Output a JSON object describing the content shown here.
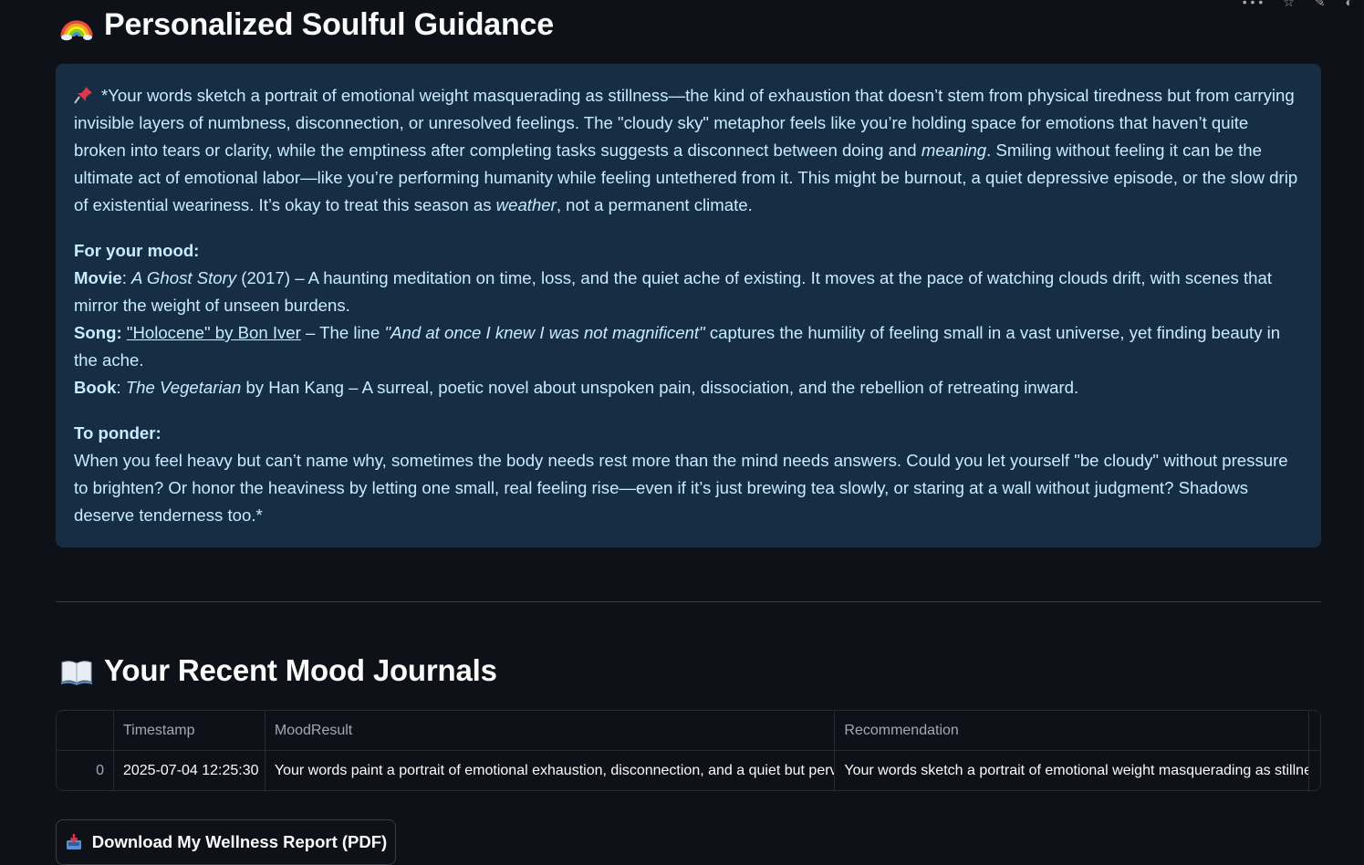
{
  "top_icons": [
    "more-icon",
    "star-icon",
    "edit-icon",
    "github-icon"
  ],
  "guidance": {
    "title": "Personalized Soulful Guidance",
    "title_icon": "rainbow-icon",
    "pin_icon": "pushpin-icon",
    "intro_1": "*Your words sketch a portrait of emotional weight masquerading as stillness—the kind of exhaustion that doesn’t stem from physical tiredness but from carrying invisible layers of numbness, disconnection, or unresolved feelings. The \"cloudy sky\" metaphor feels like you’re holding space for emotions that haven’t quite broken into tears or clarity, while the emptiness after completing tasks suggests a disconnect between doing and ",
    "intro_em_1": "meaning",
    "intro_2": ". Smiling without feeling it can be the ultimate act of emotional labor—like you’re performing humanity while feeling untethered from it. This might be burnout, a quiet depressive episode, or the slow drip of existential weariness. It’s okay to treat this season as ",
    "intro_em_2": "weather",
    "intro_3": ", not a permanent climate.",
    "mood_heading": "For your mood:",
    "movie_label": "Movie",
    "movie_colon": ": ",
    "movie_title": "A Ghost Story",
    "movie_text": " (2017) – A haunting meditation on time, loss, and the quiet ache of existing. It moves at the pace of watching clouds drift, with scenes that mirror the weight of unseen burdens.",
    "song_label": "Song:",
    "song_link": "\"Holocene\" by Bon Iver",
    "song_text_1": " – The line ",
    "song_quote": "\"And at once I knew I was not magnificent\"",
    "song_text_2": " captures the humility of feeling small in a vast universe, yet finding beauty in the ache.",
    "book_label": "Book",
    "book_colon": ": ",
    "book_title": "The Vegetarian",
    "book_text": " by Han Kang – A surreal, poetic novel about unspoken pain, dissociation, and the rebellion of retreating inward.",
    "ponder_heading": "To ponder:",
    "ponder_text": "When you feel heavy but can’t name why, sometimes the body needs rest more than the mind needs answers. Could you let yourself \"be cloudy\" without pressure to brighten? Or honor the heaviness by letting one small, real feeling rise—even if it’s just brewing tea slowly, or staring at a wall without judgment? Shadows deserve tenderness too.*"
  },
  "journals": {
    "title": "Your Recent Mood Journals",
    "title_icon": "open-book-icon",
    "columns": [
      "",
      "Timestamp",
      "MoodResult",
      "Recommendation"
    ],
    "rows": [
      {
        "index": "0",
        "timestamp": "2025-07-04 12:25:30",
        "mood_result": "Your words paint a portrait of emotional exhaustion, disconnection, and a quiet but pervasive heaviness",
        "recommendation": "Your words sketch a portrait of emotional weight masquerading as stillness"
      }
    ]
  },
  "download": {
    "label": "Download My Wellness Report (PDF)",
    "icon": "inbox-tray-icon"
  },
  "colors": {
    "background": "#0e1117",
    "info_bg": "#172d43",
    "info_text": "#c7ebff",
    "border": "#262a33"
  }
}
